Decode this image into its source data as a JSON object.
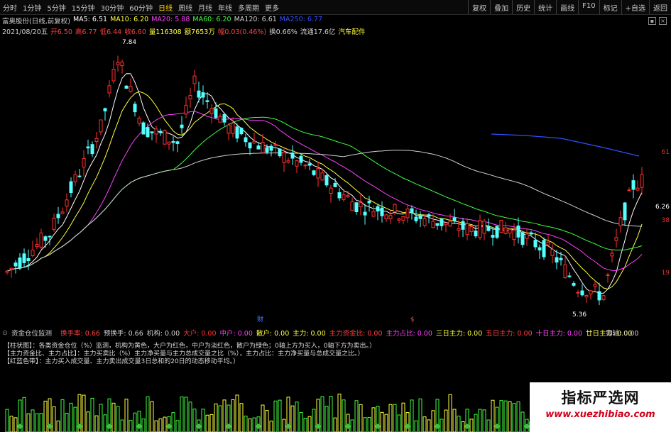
{
  "tabs": [
    "分时",
    "1分钟",
    "5分钟",
    "15分钟",
    "30分钟",
    "60分钟",
    "日线",
    "周线",
    "月线",
    "年线",
    "多周期",
    "更多"
  ],
  "active_tab": "日线",
  "tools": [
    "复权",
    "叠加",
    "历史",
    "统计",
    "画线",
    "F10",
    "标记",
    "+自选",
    "返回"
  ],
  "info1": {
    "stock": "富奥股份(日线,前复权)",
    "ma5": "MA5: 6.51",
    "ma10": "MA10: 6.20",
    "ma20": "MA20: 5.88",
    "ma60": "MA60: 6.20",
    "ma120": "MA120: 6.61",
    "ma250": "MA250: 6.77"
  },
  "info2": {
    "date": "2021/08/20五",
    "open": "开6.50",
    "high": "高6.77",
    "low": "低6.44",
    "close": "收6.60",
    "vol": "量116308",
    "amount": "额7653万",
    "change": "幅0.03(0.46%)",
    "turnover": "换0.66%",
    "float": "流通17.6亿",
    "sector": "汽车配件"
  },
  "price_labels": {
    "high": "7.84",
    "low": "5.36",
    "right_current": "6.26"
  },
  "right_axis": [
    "61",
    "38",
    "19"
  ],
  "event_markers": [
    "财",
    "$"
  ],
  "indicator": {
    "name": "资金仓位监测",
    "items": [
      {
        "label": "换手率: 0.66",
        "color": "#ff4040"
      },
      {
        "label": "预换手: 0.66",
        "color": "#d0d0d0"
      },
      {
        "label": "机构: 0.00",
        "color": "#d0d0d0"
      },
      {
        "label": "大户: 0.00",
        "color": "#ff3030"
      },
      {
        "label": "中户: 0.00",
        "color": "#ff40ff"
      },
      {
        "label": "散户: 0.00",
        "color": "#ffff40"
      },
      {
        "label": "主力: 0.00",
        "color": "#ffff40"
      },
      {
        "label": "主力资金比: 0.00",
        "color": "#ff4040"
      },
      {
        "label": "主力占比: 0.00",
        "color": "#ff40ff"
      },
      {
        "label": "三日主力: 0.00",
        "color": "#ffff40"
      },
      {
        "label": "五日主力: 0.00",
        "color": "#ff4040"
      },
      {
        "label": "十日主力: 0.00",
        "color": "#ff40ff"
      },
      {
        "label": "廿日主力: 0.00",
        "color": "#ffff40"
      }
    ],
    "zero_axis": "零轴: 0.00"
  },
  "legend_lines": [
    "【柱状图】：各类资金仓位（%）监测，机构为黄色，大户为红色，中户为淡红色，散户为绿色；0轴上方为买入，0轴下方为卖出。）",
    "【主力资金比、主力占比】：主力买卖比（%）主力净买量与主力总成交量之比（%），主力占比：主力净买量与总成交量之比。）",
    "【红蓝色带】：主力买入成交量、主力卖出成交量3日总和的20日的动态移动平均。）"
  ],
  "watermark": {
    "title": "指标严选网",
    "url": "www.xuezhibiao.com"
  }
}
